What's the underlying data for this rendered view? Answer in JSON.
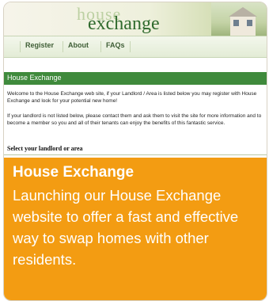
{
  "site": {
    "logo_small": "house",
    "logo_large": "exchange",
    "nav": [
      {
        "label": "Register"
      },
      {
        "label": "About"
      },
      {
        "label": "FAQs"
      }
    ],
    "section_title": "House Exchange",
    "paragraph_1": "Welcome to the House Exchange web site, if your Landlord / Area is listed below you may register with House Exchange and look for your potential new home!",
    "paragraph_2": "If your landlord is not listed below, please contact them and ask them to visit the site for more information and to become a member so you and all of their tenants can enjoy the benefits of this fantastic service.",
    "select_label": "Select your landlord or area"
  },
  "caption": {
    "title": "House Exchange",
    "description": "Launching our House Exchange website to offer a fast and effective way to swap homes with other residents."
  },
  "colors": {
    "accent_orange": "#f39c12",
    "site_green": "#3f8a3c",
    "logo_green": "#2f6a2d"
  },
  "icons": [
    "house-photo-icon"
  ]
}
